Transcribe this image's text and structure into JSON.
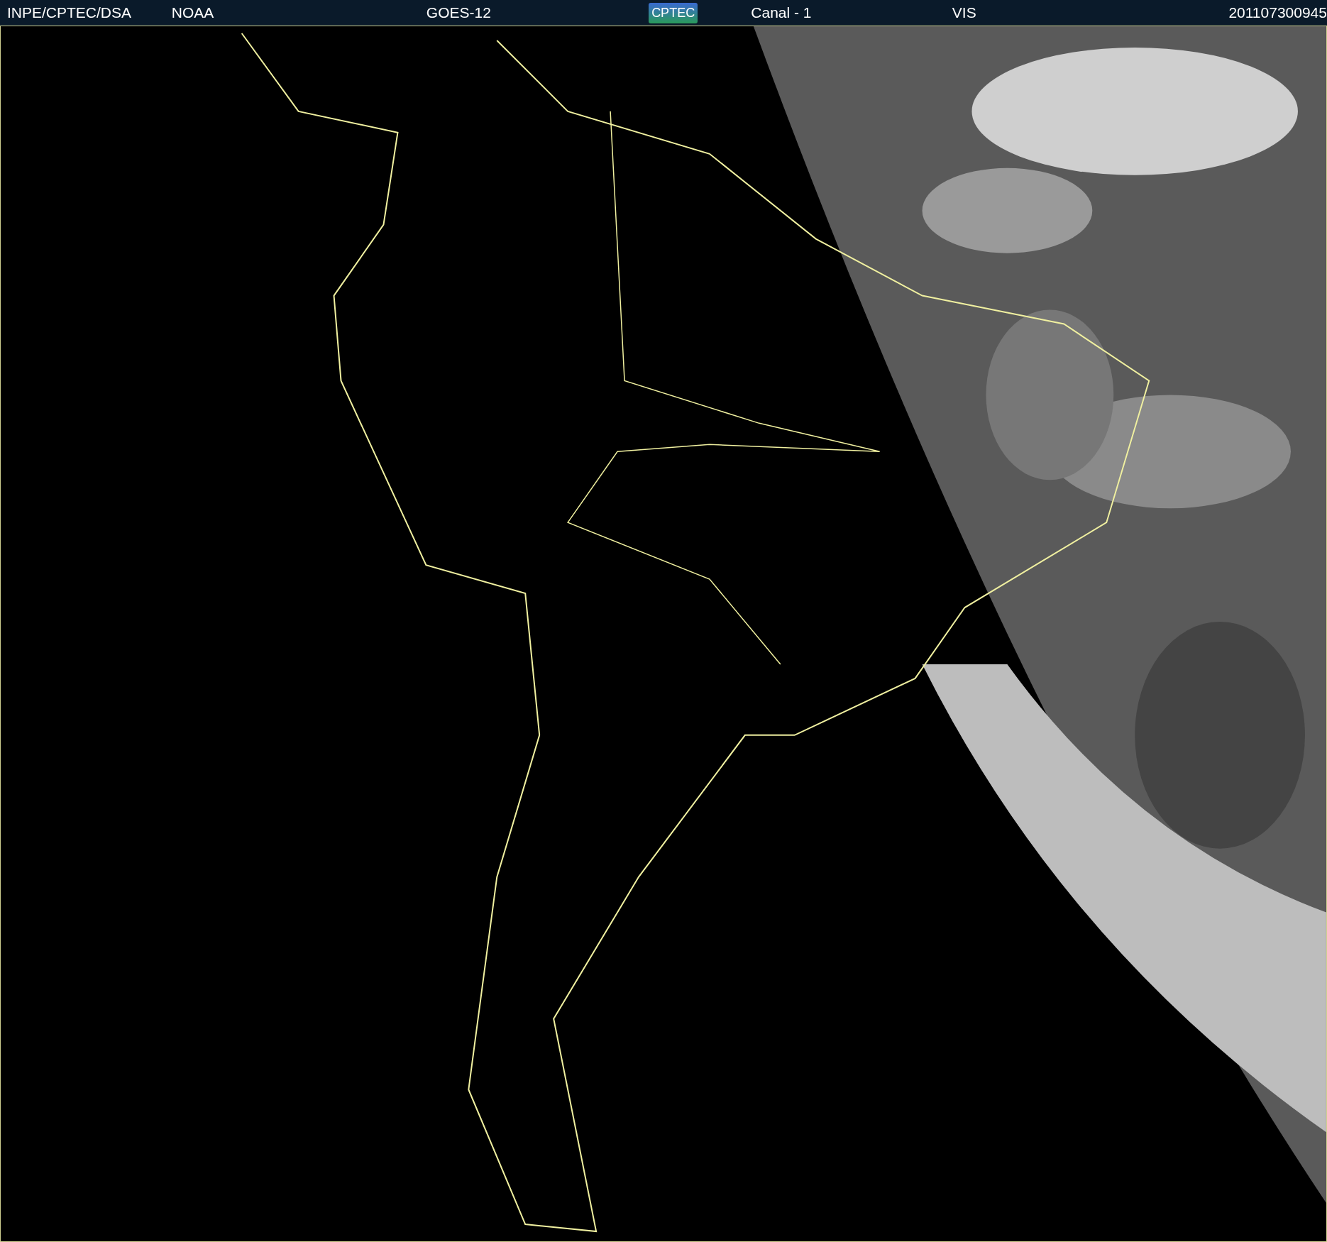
{
  "header": {
    "items": [
      {
        "kind": "text",
        "text": "INPE/CPTEC/DSA"
      },
      {
        "kind": "text",
        "text": "NOAA"
      },
      {
        "kind": "text",
        "text": "GOES-12"
      },
      {
        "kind": "logo",
        "text": "CPTEC"
      },
      {
        "kind": "text",
        "text": "Canal - 1"
      },
      {
        "kind": "text",
        "text": "VIS"
      },
      {
        "kind": "text",
        "text": "201107300945"
      }
    ]
  }
}
